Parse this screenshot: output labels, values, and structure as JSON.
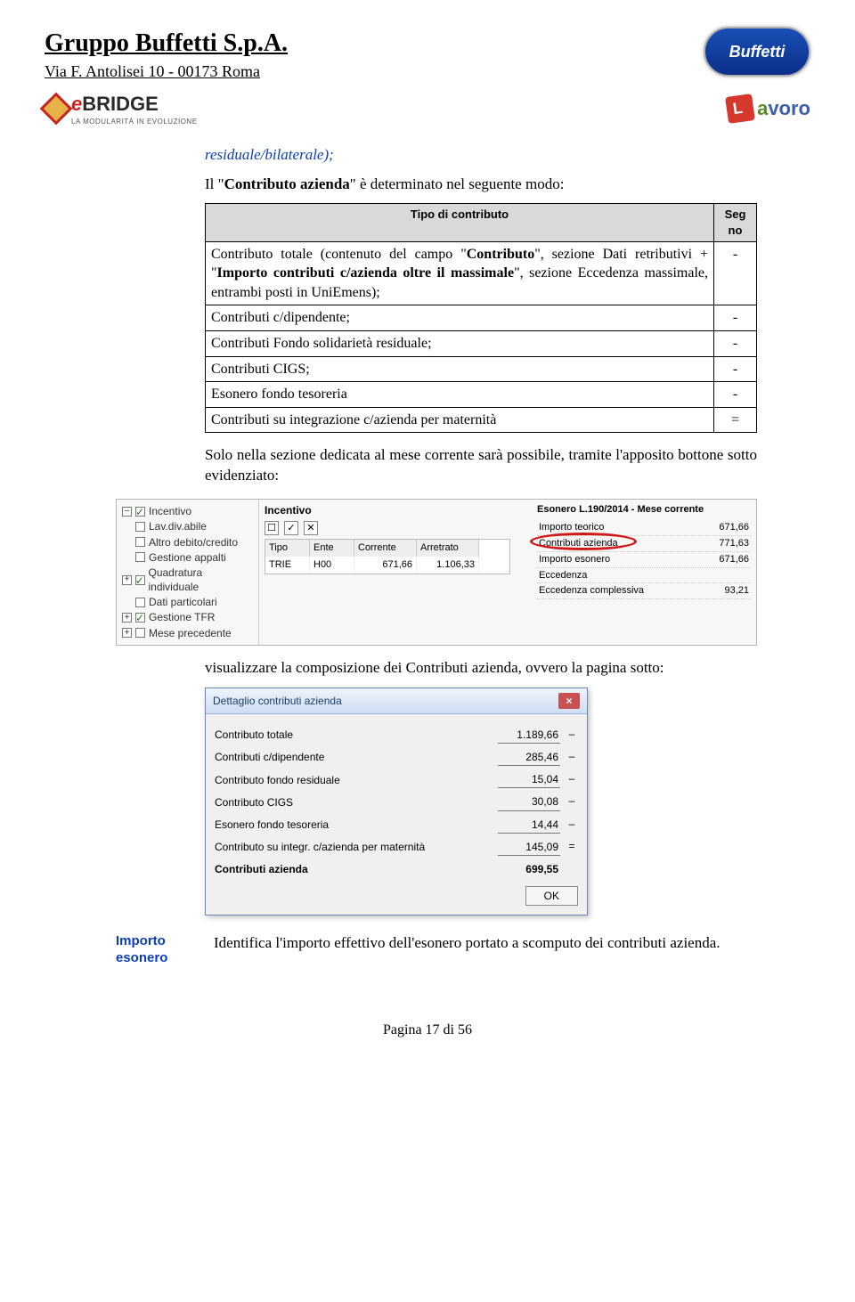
{
  "header": {
    "company": "Gruppo Buffetti S.p.A.",
    "address": "Via F. Antolisei 10 - 00173 Roma",
    "logo_text": "Buffetti",
    "ebridge_e": "e",
    "ebridge_rest": "BRIDGE",
    "ebridge_sub": "LA MODULARITÀ IN EVOLUZIONE",
    "lavoro_a": "a",
    "lavoro_rest": "voro"
  },
  "intro": {
    "p1_a": "residuale/bilaterale);",
    "p2_a": "Il \"",
    "p2_b": "Contributo azienda",
    "p2_c": "\" è determinato nel seguente modo:"
  },
  "table": {
    "h1": "Tipo di contributo",
    "h2": "Seg\nno",
    "rows": [
      {
        "text_parts": [
          "Contributo totale (contenuto del campo \"",
          "Contributo",
          "\", sezione Dati retributivi + \"",
          "Importo contributi c/azienda oltre il massimale",
          "\", sezione Eccedenza massimale, entrambi posti in UniEmens);"
        ],
        "sign": "-"
      },
      {
        "text": "Contributi c/dipendente;",
        "sign": "-"
      },
      {
        "text": "Contributi Fondo solidarietà residuale;",
        "sign": "-"
      },
      {
        "text": "Contributi CIGS;",
        "sign": "-"
      },
      {
        "text": "Esonero fondo tesoreria",
        "sign": "-"
      },
      {
        "text": "Contributi su integrazione c/azienda per maternità",
        "sign": "="
      }
    ]
  },
  "mid": {
    "p1": "Solo nella sezione dedicata al mese corrente sarà possibile, tramite l'apposito bottone sotto evidenziato:",
    "p2": "visualizzare la composizione dei Contributi azienda, ovvero la pagina sotto:"
  },
  "tree": {
    "items": [
      {
        "label": "Incentivo",
        "checked": true,
        "exp": ""
      },
      {
        "label": "Lav.div.abile",
        "checked": false,
        "exp": ""
      },
      {
        "label": "Altro debito/credito",
        "checked": false,
        "exp": ""
      },
      {
        "label": "Gestione appalti",
        "checked": false,
        "exp": ""
      },
      {
        "label": "Quadratura individuale",
        "checked": true,
        "exp": "+"
      },
      {
        "label": "Dati particolari",
        "checked": false,
        "exp": ""
      },
      {
        "label": "Gestione TFR",
        "checked": true,
        "exp": "+"
      },
      {
        "label": "Mese precedente",
        "checked": false,
        "exp": "+"
      }
    ]
  },
  "incentive": {
    "title": "Incentivo",
    "tool1": "☐",
    "tool2": "✓",
    "tool3": "✕",
    "cols": [
      "Tipo",
      "Ente",
      "Corrente",
      "Arretrato"
    ],
    "row": [
      "TRIE",
      "H00",
      "671,66",
      "1.106,33"
    ]
  },
  "esonero_panel": {
    "title": "Esonero L.190/2014 - Mese corrente",
    "rows": [
      {
        "label": "Importo teorico",
        "value": "671,66"
      },
      {
        "label": "Contributi azienda",
        "value": "771,63",
        "hl": true
      },
      {
        "label": "Importo esonero",
        "value": "671,66"
      },
      {
        "label": "Eccedenza",
        "value": ""
      },
      {
        "label": "Eccedenza complessiva",
        "value": "93,21"
      }
    ]
  },
  "dialog": {
    "title": "Dettaglio contributi azienda",
    "close": "×",
    "rows": [
      {
        "label": "Contributo totale",
        "value": "1.189,66",
        "sign": "–"
      },
      {
        "label": "Contributi c/dipendente",
        "value": "285,46",
        "sign": "–"
      },
      {
        "label": "Contributo fondo residuale",
        "value": "15,04",
        "sign": "–"
      },
      {
        "label": "Contributo CIGS",
        "value": "30,08",
        "sign": "–"
      },
      {
        "label": "Esonero fondo tesoreria",
        "value": "14,44",
        "sign": "–"
      },
      {
        "label": "Contributo su integr. c/azienda per maternità",
        "value": "145,09",
        "sign": "="
      },
      {
        "label": "Contributi azienda",
        "value": "699,55",
        "sign": "",
        "bold": true
      }
    ],
    "ok": "OK"
  },
  "definition": {
    "label1": "Importo",
    "label2": "esonero",
    "text": "Identifica l'importo effettivo dell'esonero portato a scomputo dei contributi azienda."
  },
  "footer": "Pagina 17 di 56"
}
